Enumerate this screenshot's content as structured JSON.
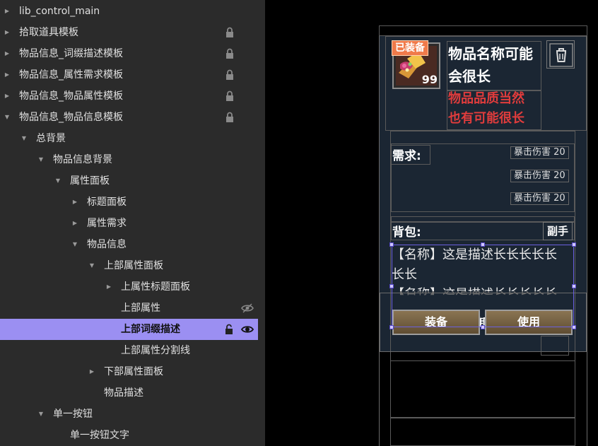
{
  "tree": {
    "items": [
      {
        "label": "lib_control_main",
        "arrow": "right",
        "indent": 0,
        "lock": false,
        "eye": "none",
        "selected": false
      },
      {
        "label": "拾取道具模板",
        "arrow": "right",
        "indent": 0,
        "lock": true,
        "eye": "none",
        "selected": false
      },
      {
        "label": "物品信息_词缀描述模板",
        "arrow": "right",
        "indent": 0,
        "lock": true,
        "eye": "none",
        "selected": false
      },
      {
        "label": "物品信息_属性需求模板",
        "arrow": "right",
        "indent": 0,
        "lock": true,
        "eye": "none",
        "selected": false
      },
      {
        "label": "物品信息_物品属性模板",
        "arrow": "right",
        "indent": 0,
        "lock": true,
        "eye": "none",
        "selected": false
      },
      {
        "label": "物品信息_物品信息模板",
        "arrow": "down",
        "indent": 0,
        "lock": true,
        "eye": "none",
        "selected": false
      },
      {
        "label": "总背景",
        "arrow": "down",
        "indent": 1,
        "lock": false,
        "eye": "none",
        "selected": false
      },
      {
        "label": "物品信息背景",
        "arrow": "down",
        "indent": 2,
        "lock": false,
        "eye": "none",
        "selected": false
      },
      {
        "label": "属性面板",
        "arrow": "down",
        "indent": 3,
        "lock": false,
        "eye": "none",
        "selected": false
      },
      {
        "label": "标题面板",
        "arrow": "right",
        "indent": 4,
        "lock": false,
        "eye": "none",
        "selected": false
      },
      {
        "label": "属性需求",
        "arrow": "right",
        "indent": 4,
        "lock": false,
        "eye": "none",
        "selected": false
      },
      {
        "label": "物品信息",
        "arrow": "down",
        "indent": 4,
        "lock": false,
        "eye": "none",
        "selected": false
      },
      {
        "label": "上部属性面板",
        "arrow": "down",
        "indent": 5,
        "lock": false,
        "eye": "none",
        "selected": false
      },
      {
        "label": "上属性标题面板",
        "arrow": "right",
        "indent": 6,
        "lock": false,
        "eye": "none",
        "selected": false
      },
      {
        "label": "上部属性",
        "arrow": "none",
        "indent": 6,
        "lock": false,
        "eye": "hidden",
        "selected": false
      },
      {
        "label": "上部词缀描述",
        "arrow": "none",
        "indent": 6,
        "lock": "open",
        "eye": "visible",
        "selected": true
      },
      {
        "label": "上部属性分割线",
        "arrow": "none",
        "indent": 6,
        "lock": false,
        "eye": "none",
        "selected": false
      },
      {
        "label": "下部属性面板",
        "arrow": "right",
        "indent": 5,
        "lock": false,
        "eye": "none",
        "selected": false
      },
      {
        "label": "物品描述",
        "arrow": "none",
        "indent": 5,
        "lock": false,
        "eye": "none",
        "selected": false
      },
      {
        "label": "单一按钮",
        "arrow": "down",
        "indent": 2,
        "lock": false,
        "eye": "none",
        "selected": false
      },
      {
        "label": "单一按钮文字",
        "arrow": "none",
        "indent": 3,
        "lock": false,
        "eye": "none",
        "selected": false
      }
    ]
  },
  "preview": {
    "equipped_badge": "已装备",
    "stack_count": "99",
    "item_name": "物品名称可能会很长",
    "quality_line1": "物品品质当然",
    "quality_line2": "也有可能很长",
    "requirement_label": "需求:",
    "requirement_tags": [
      "暴击伤害 20",
      "暴击伤害 20",
      "暴击伤害 20"
    ],
    "bag_label": "背包:",
    "bag_slot": "副手",
    "affix_line1": "【名称】这是描述长长长长长",
    "affix_line2": "长长",
    "affix_line3": "【名称】这是描述长长长长长",
    "equip_button": "装备",
    "use_button": "使用",
    "hidden_glyph": "卸"
  },
  "colors": {
    "selection": "#9b8ff2",
    "panel_bg": "#1b2633",
    "quality_red": "#e03c3c",
    "badge_orange": "#f07a4a",
    "handle_purple": "#5548c8"
  }
}
